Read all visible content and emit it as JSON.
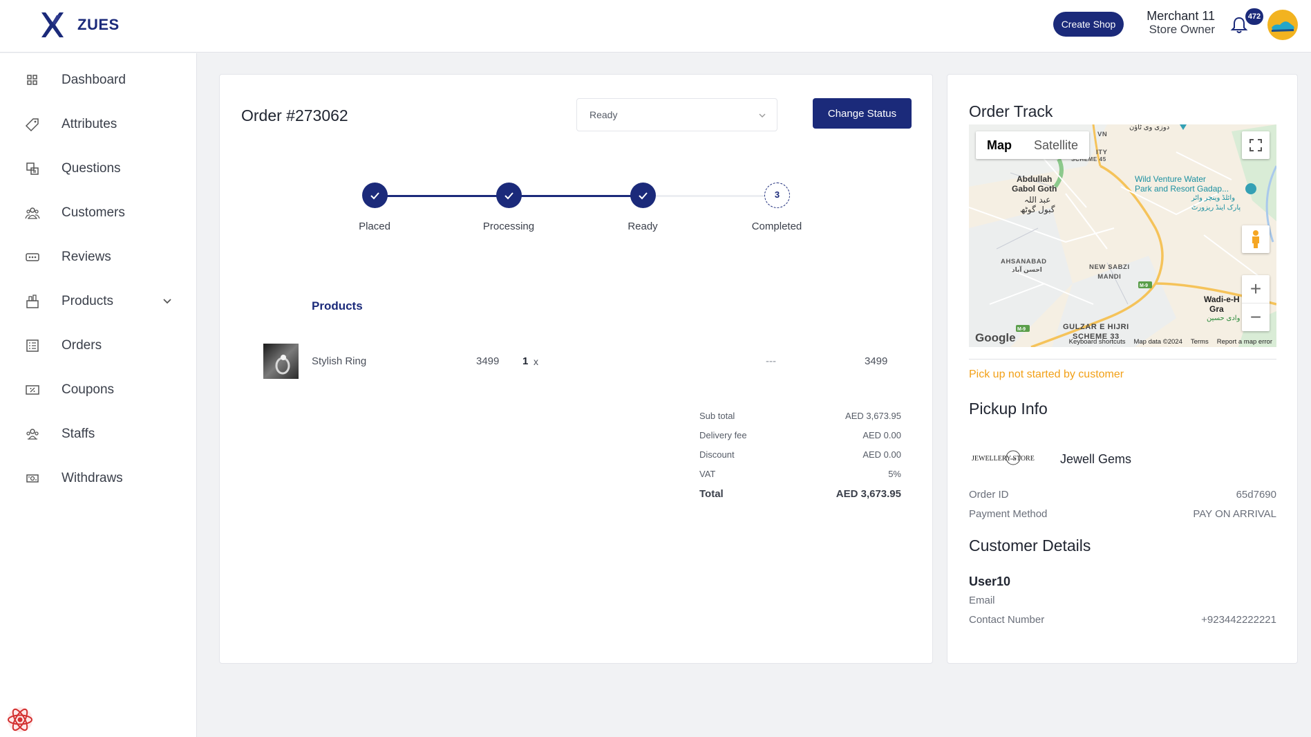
{
  "app": {
    "brand": "ZUES"
  },
  "header": {
    "create_shop_label": "Create Shop",
    "merchant_name": "Merchant 11",
    "merchant_role": "Store Owner",
    "notification_count": "472"
  },
  "sidebar": {
    "items": [
      {
        "label": "Dashboard",
        "icon": "dashboard-icon"
      },
      {
        "label": "Attributes",
        "icon": "tag-icon"
      },
      {
        "label": "Questions",
        "icon": "questions-icon"
      },
      {
        "label": "Customers",
        "icon": "customers-icon"
      },
      {
        "label": "Reviews",
        "icon": "reviews-icon"
      },
      {
        "label": "Products",
        "icon": "products-icon"
      },
      {
        "label": "Orders",
        "icon": "orders-icon"
      },
      {
        "label": "Coupons",
        "icon": "coupon-icon"
      },
      {
        "label": "Staffs",
        "icon": "staffs-icon"
      },
      {
        "label": "Withdraws",
        "icon": "withdraw-icon"
      }
    ]
  },
  "order": {
    "title": "Order #273062",
    "status_value": "Ready",
    "change_status_label": "Change Status",
    "steps": [
      {
        "label": "Placed",
        "done": true
      },
      {
        "label": "Processing",
        "done": true
      },
      {
        "label": "Ready",
        "done": true
      },
      {
        "label": "Completed",
        "done": false,
        "number": "3"
      }
    ],
    "products_heading": "Products",
    "products": [
      {
        "name": "Stylish Ring",
        "price": "3499",
        "qty": "1",
        "multiplier": "x",
        "variant": "---",
        "total": "3499"
      }
    ],
    "summary": [
      {
        "label": "Sub total",
        "value": "AED 3,673.95"
      },
      {
        "label": "Delivery fee",
        "value": "AED 0.00"
      },
      {
        "label": "Discount",
        "value": "AED 0.00"
      },
      {
        "label": "VAT",
        "value": "5%"
      },
      {
        "label": "Total",
        "value": "AED 3,673.95"
      }
    ]
  },
  "side": {
    "order_track_title": "Order Track",
    "map": {
      "type_map": "Map",
      "type_satellite": "Satellite",
      "labels": {
        "abdullah": "Abdullah\nGabol Goth",
        "abdullah_urdu": "عبد اللہ\nگبول گوٹھ",
        "wild_venture": "Wild Venture Water\nPark and Resort Gadap...",
        "wild_venture_urdu": "وائلڈ وینچر واٹر\nپارک اینڈ ریزورٹ",
        "ahsanabad": "AHSANABAD",
        "ahsanabad_urdu": "احسن آباد",
        "new_sabzi": "NEW SABZI\nMANDI",
        "gulzar": "GULZAR E HIJRI\nSCHEME 33",
        "wadi": "Wadi-e-H",
        "gra": "Gra",
        "wadi_urdu": "وادی حسین",
        "top_urdu": "دوزی وی ٹاؤن",
        "city": "ITY",
        "scheme45": "SCHEME 45",
        "vn": "VN",
        "m9_a": "M-9",
        "m9_b": "M-9"
      },
      "google": "Google",
      "footer": [
        "Keyboard shortcuts",
        "Map data ©2024",
        "Terms",
        "Report a map error"
      ]
    },
    "pickup_status": "Pick up not started by customer",
    "pickup_title": "Pickup Info",
    "store_logo_text": "JEWELLERY STORE",
    "store_name": "Jewell Gems",
    "order_id_label": "Order ID",
    "order_id_value": "65d7690",
    "payment_label": "Payment Method",
    "payment_value": "PAY ON ARRIVAL",
    "customer_title": "Customer Details",
    "customer_name": "User10",
    "email_label": "Email",
    "email_value": "",
    "contact_label": "Contact Number",
    "contact_value": "+923442222221"
  },
  "colors": {
    "brand": "#1b2a7a",
    "warning": "#f2a017",
    "background": "#f1f2f4"
  }
}
